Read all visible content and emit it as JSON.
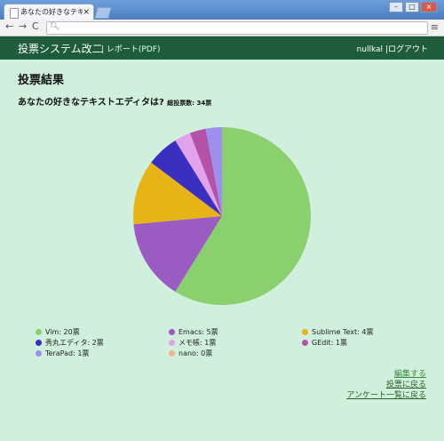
{
  "browser": {
    "tab_title": "あなたの好きなテキスト:",
    "tab_close": "×",
    "window_buttons": [
      "–",
      "□",
      "×"
    ],
    "address": "",
    "nav": [
      "←",
      "→",
      "C"
    ],
    "menu_icon": "≡"
  },
  "app": {
    "brand": "投票システム改二",
    "report_link": "| レポート(PDF)",
    "user": "nullkal",
    "separator": "|",
    "logout": "ログアウト"
  },
  "page": {
    "title": "投票結果",
    "question": "あなたの好きなテキストエディタは?",
    "total": "総投票数: 34票"
  },
  "chart_data": {
    "type": "pie",
    "title": "",
    "slices": [
      {
        "label": "Vim",
        "value": 20,
        "legend": "Vim: 20票",
        "color": "#8bd06f"
      },
      {
        "label": "Emacs",
        "value": 5,
        "legend": "Emacs: 5票",
        "color": "#9a5cc2"
      },
      {
        "label": "Sublime Text",
        "value": 4,
        "legend": "Sublime Text: 4票",
        "color": "#e6b417"
      },
      {
        "label": "秀丸エディタ",
        "value": 2,
        "legend": "秀丸エディタ: 2票",
        "color": "#3a2fbf"
      },
      {
        "label": "メモ帳",
        "value": 1,
        "legend": "メモ帳: 1票",
        "color": "#e2a2ec"
      },
      {
        "label": "GEdit",
        "value": 1,
        "legend": "GEdit: 1票",
        "color": "#b452a8"
      },
      {
        "label": "TeraPad",
        "value": 1,
        "legend": "TeraPad: 1票",
        "color": "#9c8ff0"
      },
      {
        "label": "nano",
        "value": 0,
        "legend": "nano: 0票",
        "color": "#f2b48a"
      }
    ],
    "legend_order": [
      0,
      3,
      6,
      1,
      4,
      7,
      2,
      5
    ],
    "legend_position": "bottom",
    "slice_order_clockwise_from_top": [
      0,
      1,
      2,
      3,
      4,
      5,
      6,
      7
    ]
  },
  "links": {
    "edit": "編集する",
    "back_vote": "投票に戻る",
    "back_list": "アンケート一覧に戻る"
  }
}
